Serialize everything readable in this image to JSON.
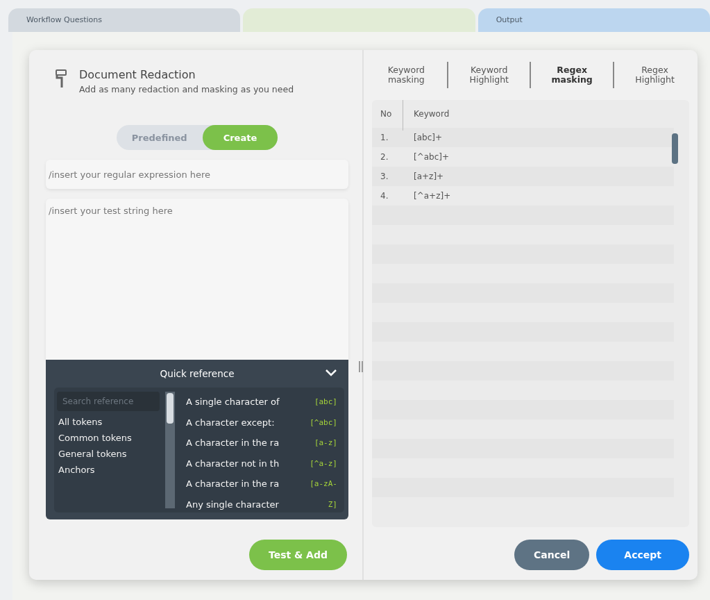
{
  "background_tabs": [
    {
      "label": "Workflow Questions",
      "color": "#d3d9df"
    },
    {
      "color": "#e2ecd6"
    },
    {
      "label": "Output",
      "color": "#bcd6ef"
    }
  ],
  "header": {
    "title": "Document Redaction",
    "subtitle": "Add as many redaction and masking as you need"
  },
  "mode_toggle": [
    {
      "label": "Predefined",
      "selected": false
    },
    {
      "label": "Create",
      "selected": true
    }
  ],
  "regex_field": {
    "placeholder": "/insert your regular expression here"
  },
  "test_field": {
    "placeholder": "/insert your test string here"
  },
  "quick_reference": {
    "title": "Quick reference",
    "expanded": true,
    "search": {
      "placeholder": "Search reference"
    },
    "categories": [
      "All tokens",
      "Common tokens",
      "General tokens",
      "Anchors"
    ],
    "tokens": [
      {
        "description": "A single character of",
        "code": "[abc]"
      },
      {
        "description": "A character except:",
        "code": "[^abc]"
      },
      {
        "description": "A character in the ra",
        "code": "[a-z]"
      },
      {
        "description": "A character not in th",
        "code": "[^a-z]"
      },
      {
        "description": "A character in the ra",
        "code": "[a-zA-"
      },
      {
        "description": "Any single character",
        "code": "Z]"
      }
    ]
  },
  "test_add_button": "Test & Add",
  "tabs": [
    {
      "label": "Keyword masking",
      "selected": false
    },
    {
      "label": "Keyword Highlight",
      "selected": false
    },
    {
      "label": "Regex masking",
      "selected": true
    },
    {
      "label": "Regex Highlight",
      "selected": false
    }
  ],
  "table": {
    "columns": [
      "No",
      "Keyword"
    ],
    "rows": [
      [
        "1.",
        "[abc]+"
      ],
      [
        "2.",
        "[^abc]+"
      ],
      [
        "3.",
        "[a+z]+"
      ],
      [
        "4.",
        "[^a+z]+"
      ]
    ]
  },
  "buttons": [
    {
      "label": "Cancel",
      "kind": "secondary"
    },
    {
      "label": "Accept",
      "kind": "primary"
    }
  ]
}
